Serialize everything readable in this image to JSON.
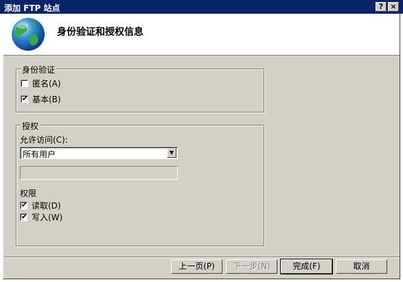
{
  "window": {
    "title": "添加 FTP 站点",
    "help_label": "?",
    "close_label": "×"
  },
  "header": {
    "title": "身份验证和授权信息"
  },
  "auth_group": {
    "legend": "身份验证",
    "anonymous": {
      "label": "匿名(A)",
      "checked": false
    },
    "basic": {
      "label": "基本(B)",
      "checked": true
    }
  },
  "authz_group": {
    "legend": "授权",
    "allow_access_label": "允许访问(C):",
    "allow_access_value": "所有用户",
    "permissions_label": "权限",
    "read": {
      "label": "读取(D)",
      "checked": true
    },
    "write": {
      "label": "写入(W)",
      "checked": true
    }
  },
  "buttons": {
    "prev": "上一页(P)",
    "next": "下一步(N)",
    "finish": "完成(F)",
    "cancel": "取消"
  },
  "check_mark": "✔",
  "dropdown_arrow": "▼",
  "colors": {
    "titlebar": "#0a246a",
    "dialog": "#d4d0c8"
  }
}
